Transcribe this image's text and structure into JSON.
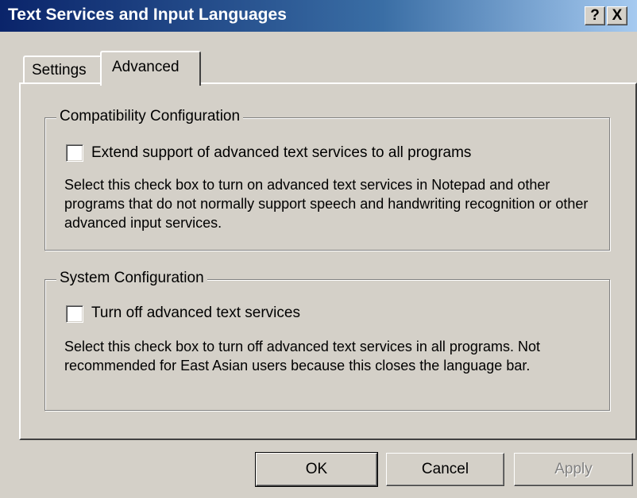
{
  "window": {
    "title": "Text Services and Input Languages",
    "help_label": "?",
    "close_label": "X",
    "title_color": "#0a246a"
  },
  "tabs": [
    {
      "label": "Settings",
      "selected": false
    },
    {
      "label": "Advanced",
      "selected": true
    }
  ],
  "compatibility": {
    "legend": "Compatibility Configuration",
    "checkbox_label": "Extend support of advanced text services to all programs",
    "checked": false,
    "description": "Select this check box to turn on advanced text services in Notepad and other programs that do not normally support speech and handwriting recognition or other advanced input services."
  },
  "system": {
    "legend": "System Configuration",
    "checkbox_label": "Turn off advanced text services",
    "checked": false,
    "description": "Select this check box to turn off advanced text services in all programs. Not recommended for East Asian users because this closes the language bar."
  },
  "buttons": {
    "ok": "OK",
    "cancel": "Cancel",
    "apply": "Apply",
    "apply_enabled": false
  }
}
